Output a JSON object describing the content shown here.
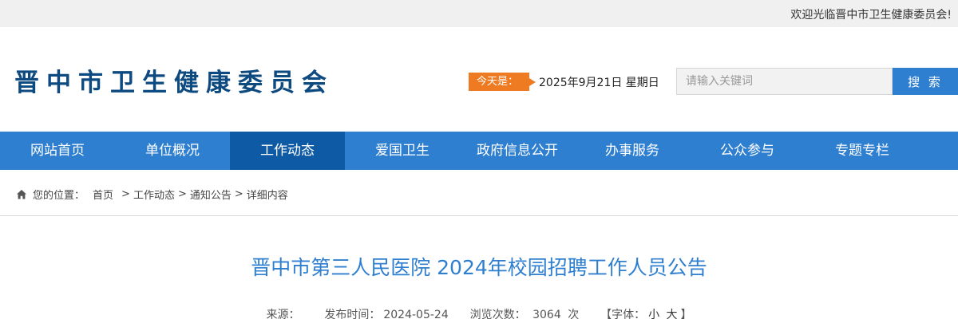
{
  "topbar": {
    "welcome": "欢迎光临晋中市卫生健康委员会!"
  },
  "header": {
    "site_title": "晋中市卫生健康委员会",
    "today_label": "今天是：",
    "date_text": "2025年9月21日 星期日"
  },
  "search": {
    "placeholder": "请输入关键词",
    "button_label": "搜 索"
  },
  "nav": {
    "items": [
      {
        "label": "网站首页"
      },
      {
        "label": "单位概况"
      },
      {
        "label": "工作动态"
      },
      {
        "label": "爱国卫生"
      },
      {
        "label": "政府信息公开"
      },
      {
        "label": "办事服务"
      },
      {
        "label": "公众参与"
      },
      {
        "label": "专题专栏"
      }
    ],
    "active_index": 2
  },
  "breadcrumb": {
    "prefix": "您的位置：",
    "items": [
      {
        "label": "首页"
      },
      {
        "label": "工作动态"
      },
      {
        "label": "通知公告"
      },
      {
        "label": "详细内容"
      }
    ],
    "separator": ">"
  },
  "article": {
    "title": "晋中市第三人民医院 2024年校园招聘工作人员公告",
    "source_label": "来源：",
    "publish_label": "发布时间：",
    "publish_date": "2024-05-24",
    "views_label": "浏览次数：",
    "views_count": "3064",
    "views_unit": "次",
    "font_label": "【字体：",
    "font_small": "小",
    "font_large": "大",
    "font_close": "】"
  },
  "colors": {
    "brand_blue": "#2f7fd0",
    "nav_active": "#0f5aa5",
    "title_navy": "#0d4a80",
    "accent_orange": "#ee7b22"
  }
}
